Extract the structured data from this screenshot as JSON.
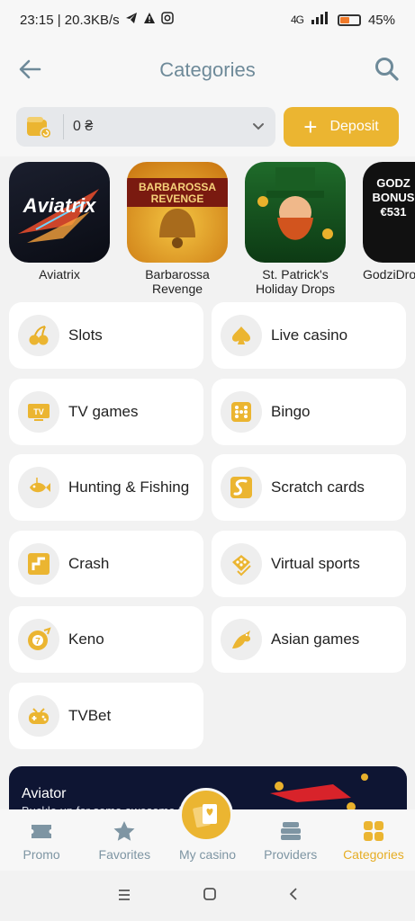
{
  "status_bar": {
    "time_speed": "23:15 | 20.3KB/s",
    "network": "4G",
    "battery": "45%"
  },
  "header": {
    "title": "Categories",
    "back_icon": "back-arrow-icon",
    "search_icon": "search-icon"
  },
  "balance": {
    "value": "0 ₴",
    "deposit_label": "Deposit"
  },
  "games": [
    {
      "name": "Aviatrix"
    },
    {
      "name": "Barbarossa Revenge"
    },
    {
      "name": "St. Patrick's Holiday Drops"
    },
    {
      "name": "GodziDro Frenzy: S"
    }
  ],
  "game_art_text": {
    "aviatrix": "Aviatrix",
    "barbarossa": "BARBAROSSA REVENGE",
    "godzi": "GODZ BONUS €531"
  },
  "categories": [
    {
      "label": "Slots",
      "icon": "cherry-icon"
    },
    {
      "label": "Live casino",
      "icon": "spade-icon"
    },
    {
      "label": "TV games",
      "icon": "tv-icon"
    },
    {
      "label": "Bingo",
      "icon": "bingo-icon"
    },
    {
      "label": "Hunting & Fishing",
      "icon": "fish-icon"
    },
    {
      "label": "Scratch cards",
      "icon": "scratch-icon"
    },
    {
      "label": "Crash",
      "icon": "crash-icon"
    },
    {
      "label": "Virtual sports",
      "icon": "virtual-sports-icon"
    },
    {
      "label": "Keno",
      "icon": "keno-icon"
    },
    {
      "label": "Asian games",
      "icon": "dragon-icon"
    },
    {
      "label": "TVBet",
      "icon": "gamepad-icon"
    }
  ],
  "banner": {
    "title": "Aviator",
    "subtitle": "Buckle up for some awesome fun!"
  },
  "bottom_nav": [
    {
      "label": "Promo",
      "icon": "ticket-icon"
    },
    {
      "label": "Favorites",
      "icon": "star-icon"
    },
    {
      "label": "My casino",
      "icon": "cards-icon"
    },
    {
      "label": "Providers",
      "icon": "providers-icon"
    },
    {
      "label": "Categories",
      "icon": "grid-icon",
      "active": true
    }
  ],
  "colors": {
    "accent": "#ebb531",
    "header_text": "#6e8a99",
    "nav_inactive": "#7e95a3"
  }
}
